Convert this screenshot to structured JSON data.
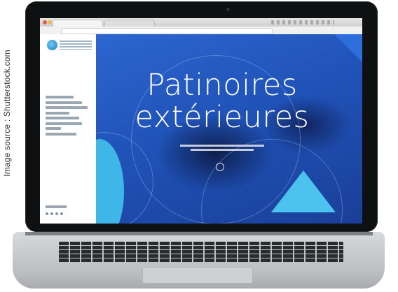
{
  "credit": {
    "text": "Image source : Shutterstock.com"
  },
  "hero": {
    "title": "Patinoires extérieures"
  },
  "icons": [
    "site-logo-icon",
    "scroll-down-icon",
    "social-icon"
  ],
  "colors": {
    "hero_blue": "#2053b8",
    "accent_cyan": "#4cc2ee",
    "laptop_bezel": "#0f1012",
    "laptop_body": "#bcbec1"
  }
}
